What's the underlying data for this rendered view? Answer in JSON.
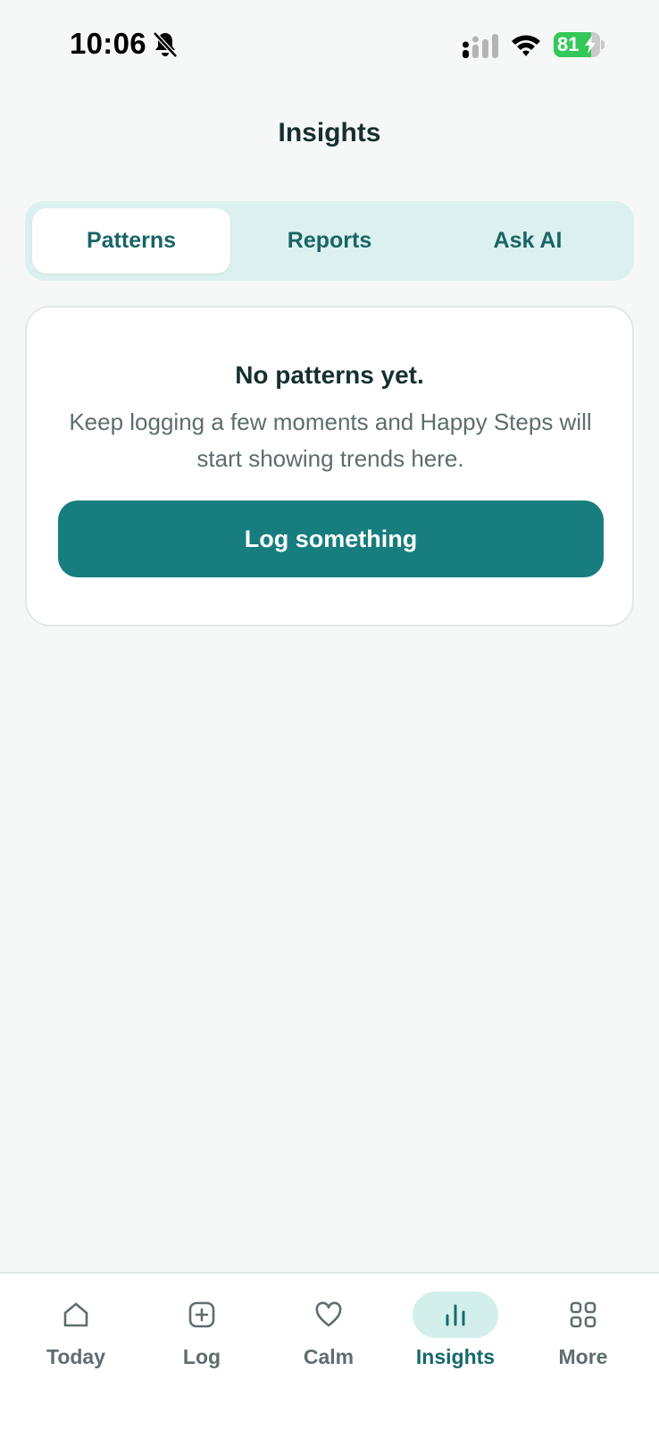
{
  "status_bar": {
    "time": "10:06",
    "battery_level": "81",
    "battery_fraction": 0.81,
    "icons": [
      "bell-slash-icon",
      "signal-icon",
      "wifi-icon",
      "battery-icon"
    ]
  },
  "header": {
    "title": "Insights"
  },
  "segmented_control": {
    "tabs": [
      {
        "label": "Patterns",
        "active": true
      },
      {
        "label": "Reports",
        "active": false
      },
      {
        "label": "Ask AI",
        "active": false
      }
    ]
  },
  "empty_state": {
    "title": "No patterns yet.",
    "body": "Keep logging a few moments and Happy Steps will start showing trends here.",
    "button_label": "Log something"
  },
  "tab_bar": {
    "items": [
      {
        "label": "Today",
        "icon": "home-icon"
      },
      {
        "label": "Log",
        "icon": "plus-square-icon"
      },
      {
        "label": "Calm",
        "icon": "heart-icon"
      },
      {
        "label": "Insights",
        "icon": "bar-chart-icon",
        "active": true
      },
      {
        "label": "More",
        "icon": "grid-icon"
      }
    ]
  },
  "colors": {
    "accent": "#177d7e",
    "tab_active_bg": "#d3efec",
    "segment_bg": "#dcf1ef",
    "background": "#f6f8f8"
  }
}
